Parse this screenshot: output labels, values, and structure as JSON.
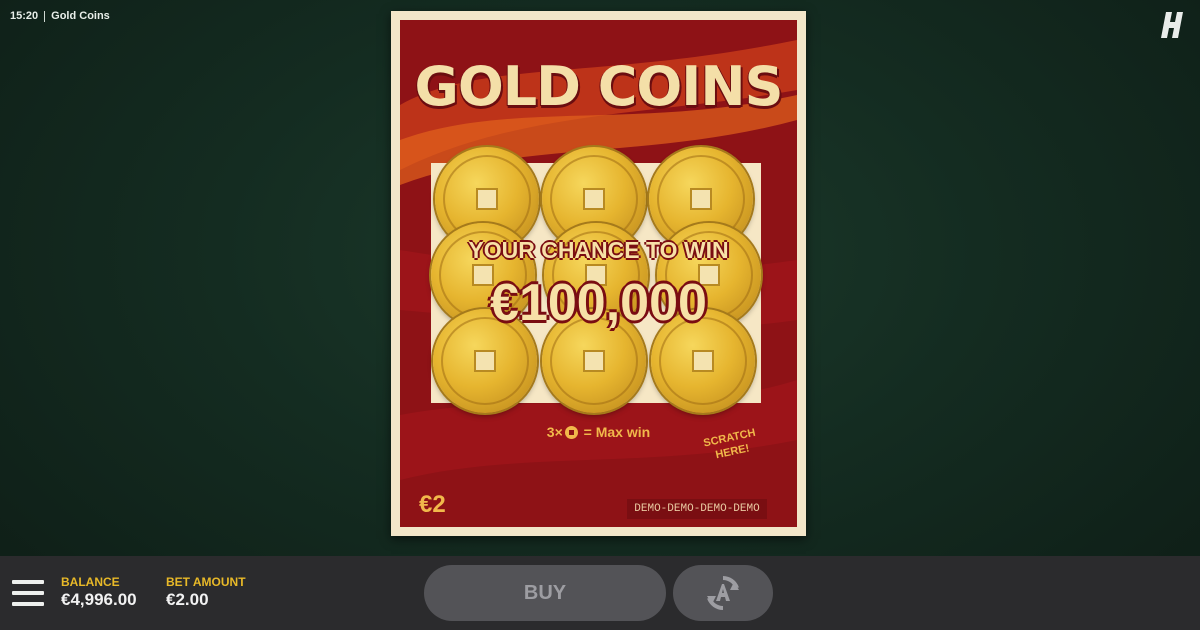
{
  "status_bar": {
    "time": "15:20",
    "app_title": "Gold Coins"
  },
  "brand": {
    "logo_letter": "H"
  },
  "ticket": {
    "title": "GOLD COINS",
    "promo_line1": "YOUR CHANCE TO WIN",
    "promo_line2": "€100,000",
    "rule_prefix": "3×",
    "rule_suffix": "= Max win",
    "scratch_hint_line1": "SCRATCH",
    "scratch_hint_line2": "HERE!",
    "price": "€2",
    "demo_label": "DEMO-DEMO-DEMO-DEMO",
    "coins_count_visible": 9
  },
  "bottom_bar": {
    "balance_label": "BALANCE",
    "balance_value": "€4,996.00",
    "bet_label": "BET AMOUNT",
    "bet_value": "€2.00",
    "buy_label": "BUY"
  },
  "icons": {
    "menu": "hamburger-menu-icon",
    "autoplay": "autoplay-icon",
    "logo": "brand-logo-icon"
  },
  "colors": {
    "ticket_red": "#8e1216",
    "ticket_cream": "#f2e6c9",
    "gold_text": "#f1b84b",
    "label_yellow": "#e8b928",
    "button_grey": "#535357"
  }
}
